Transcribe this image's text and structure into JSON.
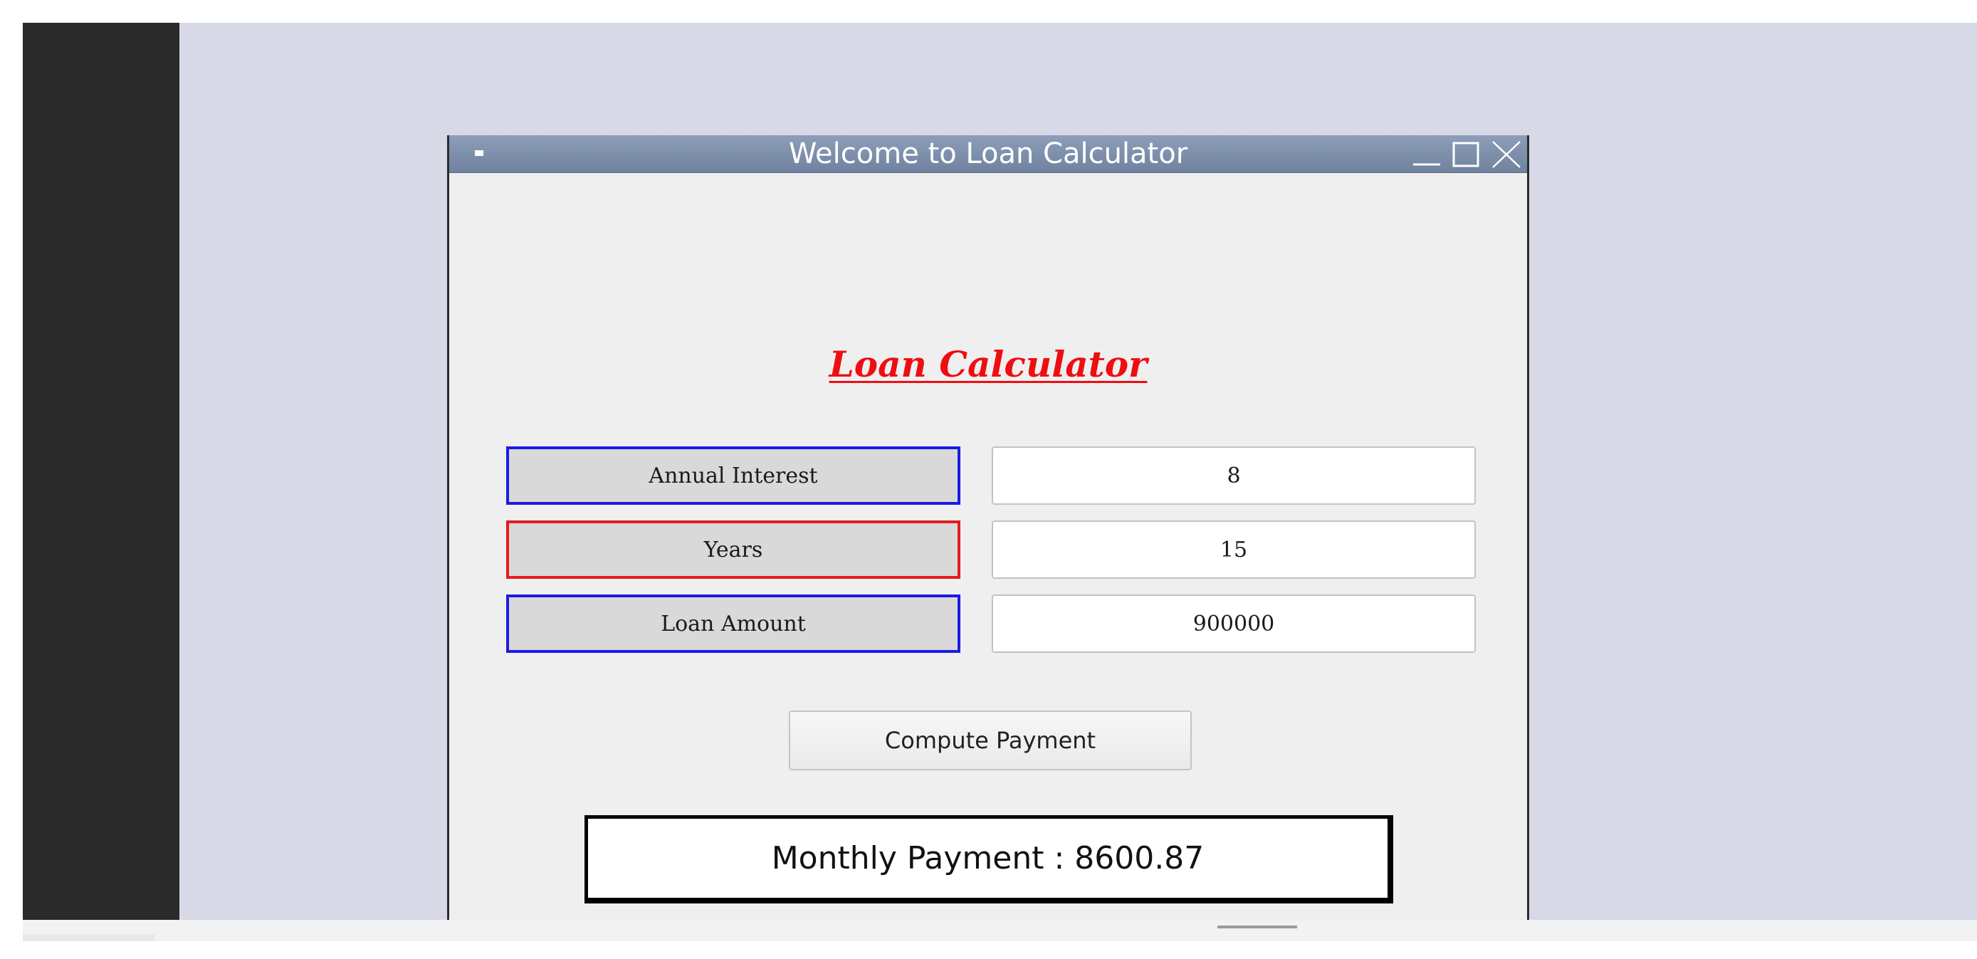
{
  "window": {
    "title": "Welcome to Loan Calculator",
    "controls": {
      "minimize_icon": "minimize-icon",
      "maximize_icon": "maximize-icon",
      "close_icon": "close-icon"
    }
  },
  "app": {
    "heading": "Loan Calculator",
    "fields": [
      {
        "label": "Annual Interest",
        "value": "8",
        "label_border_color": "#1b1be6"
      },
      {
        "label": "Years",
        "value": "15",
        "label_border_color": "#e51b1b"
      },
      {
        "label": "Loan Amount",
        "value": "900000",
        "label_border_color": "#1b1be6"
      }
    ],
    "compute_button_label": "Compute Payment",
    "result_text": "Monthly Payment : 8600.87"
  },
  "colors": {
    "heading": "#ee0e12",
    "titlebar": "#7f91ad",
    "desktop": "#d7d9e6",
    "side_strip": "#2a2a2a"
  }
}
